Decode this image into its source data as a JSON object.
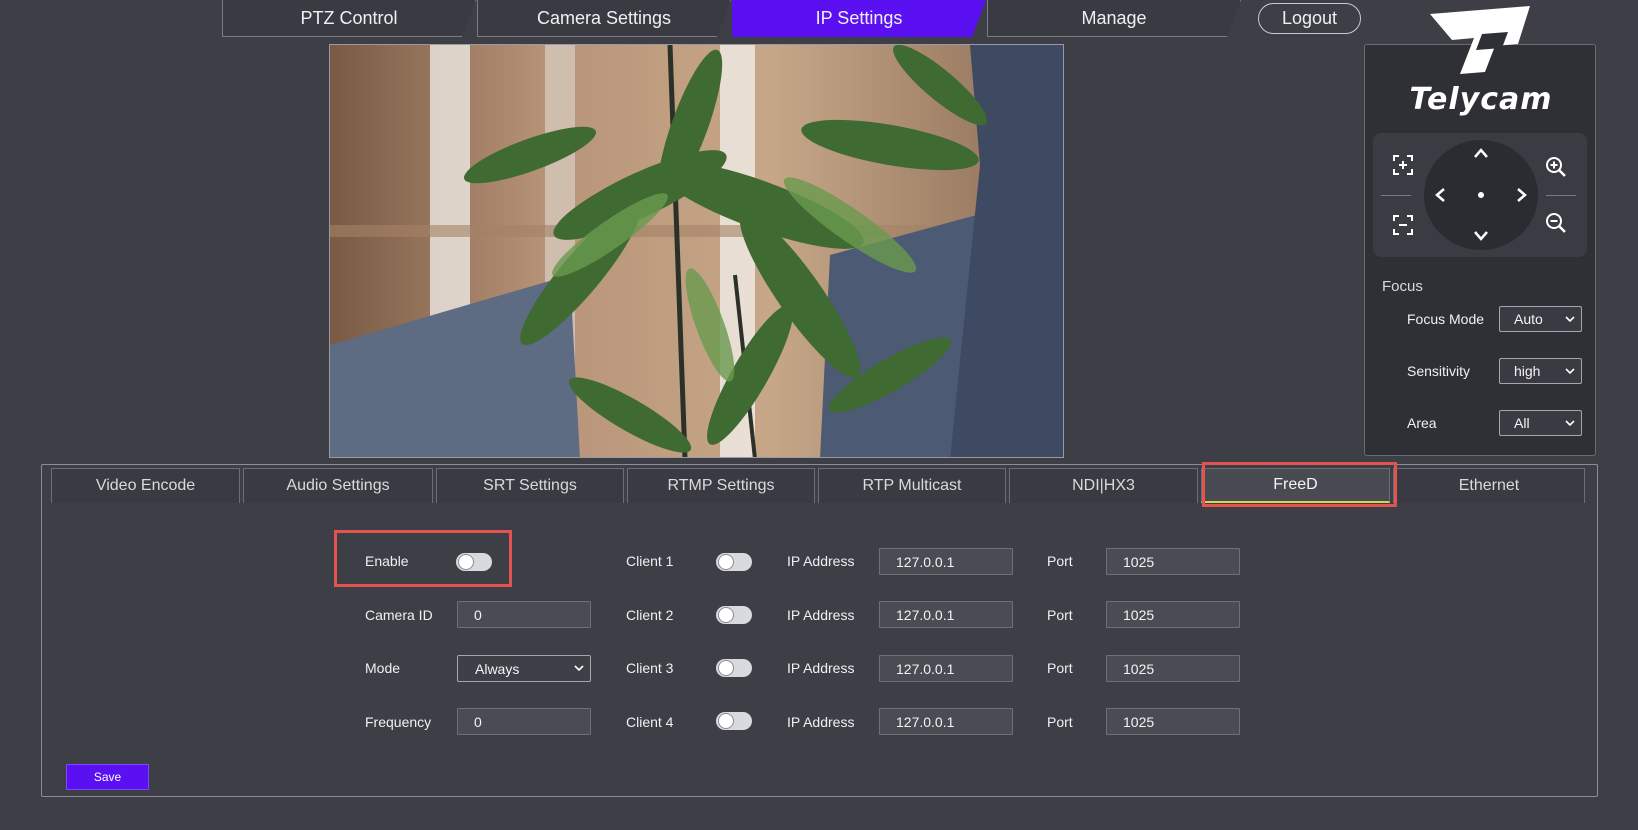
{
  "nav": {
    "tabs": [
      {
        "label": "PTZ Control"
      },
      {
        "label": "Camera Settings"
      },
      {
        "label": "IP Settings"
      },
      {
        "label": "Manage"
      }
    ],
    "active_tab": "IP Settings",
    "logout_label": "Logout"
  },
  "brand": {
    "name": "Telycam"
  },
  "focus": {
    "title": "Focus",
    "rows": [
      {
        "label": "Focus Mode",
        "value": "Auto"
      },
      {
        "label": "Sensitivity",
        "value": "high"
      },
      {
        "label": "Area",
        "value": "All"
      }
    ]
  },
  "subtabs": [
    {
      "label": "Video Encode"
    },
    {
      "label": "Audio Settings"
    },
    {
      "label": "SRT Settings"
    },
    {
      "label": "RTMP Settings"
    },
    {
      "label": "RTP Multicast"
    },
    {
      "label": "NDI|HX3"
    },
    {
      "label": "FreeD"
    },
    {
      "label": "Ethernet"
    }
  ],
  "active_subtab": "FreeD",
  "freed": {
    "enable_label": "Enable",
    "camera_id_label": "Camera ID",
    "camera_id": "0",
    "mode_label": "Mode",
    "mode": "Always",
    "frequency_label": "Frequency",
    "frequency": "0",
    "clients": [
      {
        "label": "Client 1",
        "ip_label": "IP Address",
        "ip": "127.0.0.1",
        "port_label": "Port",
        "port": "1025"
      },
      {
        "label": "Client 2",
        "ip_label": "IP Address",
        "ip": "127.0.0.1",
        "port_label": "Port",
        "port": "1025"
      },
      {
        "label": "Client 3",
        "ip_label": "IP Address",
        "ip": "127.0.0.1",
        "port_label": "Port",
        "port": "1025"
      },
      {
        "label": "Client 4",
        "ip_label": "IP Address",
        "ip": "127.0.0.1",
        "port_label": "Port",
        "port": "1025"
      }
    ]
  },
  "save_label": "Save",
  "colors": {
    "accent": "#5a10f0",
    "background": "#3e3f46",
    "highlight": "#e25451",
    "active_underline": "#d8d34a"
  },
  "icons": {
    "joystick": [
      "chevron-up-icon",
      "chevron-down-icon",
      "chevron-left-icon",
      "chevron-right-icon",
      "center-dot-icon"
    ],
    "pad": [
      "focus-near-icon",
      "focus-far-icon",
      "zoom-in-icon",
      "zoom-out-icon"
    ]
  }
}
